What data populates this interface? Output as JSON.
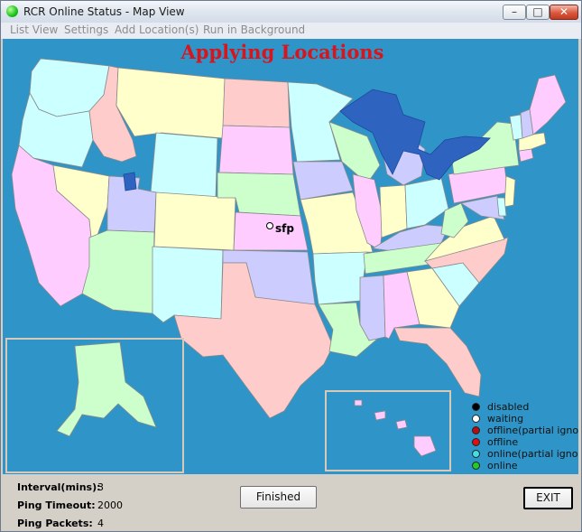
{
  "window": {
    "title": "RCR Online Status - Map View"
  },
  "menu": {
    "list_view": "List View",
    "settings": "Settings",
    "add_locations": "Add Location(s)",
    "run_background": "Run in Background"
  },
  "map": {
    "status_title": "Applying Locations",
    "location_label": "sfp"
  },
  "legend": [
    {
      "label": "disabled",
      "color": "#000000"
    },
    {
      "label": "waiting",
      "color": "#ffffff"
    },
    {
      "label": "offline(partial ignore)",
      "color": "#b01010"
    },
    {
      "label": "offline",
      "color": "#e01010"
    },
    {
      "label": "online(partial ignore)",
      "color": "#40e0e0"
    },
    {
      "label": "online",
      "color": "#22cc22"
    }
  ],
  "stats": {
    "interval_label": "Interval(mins):",
    "interval_value": "3",
    "timeout_label": "Ping Timeout:",
    "timeout_value": "2000",
    "packets_label": "Ping Packets:",
    "packets_value": "4"
  },
  "buttons": {
    "finished": "Finished",
    "exit": "EXIT"
  },
  "colors": {
    "water": "#2f95c8",
    "title_red": "#d8141c"
  }
}
